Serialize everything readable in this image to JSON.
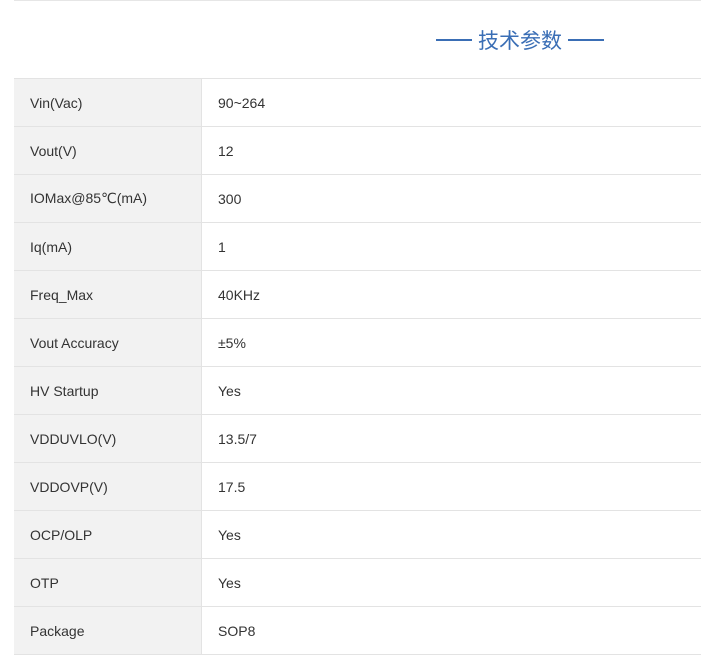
{
  "heading": {
    "title": "技术参数"
  },
  "specs": [
    {
      "param": "Vin(Vac)",
      "value": "90~264"
    },
    {
      "param": "Vout(V)",
      "value": "12"
    },
    {
      "param": "IOMax@85℃(mA)",
      "value": "300"
    },
    {
      "param": "Iq(mA)",
      "value": "1"
    },
    {
      "param": "Freq_Max",
      "value": "40KHz"
    },
    {
      "param": "Vout Accuracy",
      "value": "±5%"
    },
    {
      "param": "HV Startup",
      "value": "Yes"
    },
    {
      "param": "VDDUVLO(V)",
      "value": "13.5/7"
    },
    {
      "param": "VDDOVP(V)",
      "value": "17.5"
    },
    {
      "param": "OCP/OLP",
      "value": "Yes"
    },
    {
      "param": "OTP",
      "value": "Yes"
    },
    {
      "param": "Package",
      "value": "SOP8"
    }
  ],
  "colors": {
    "accent": "#3a6eb5",
    "label_cell_bg": "#f2f2f2",
    "border": "#e3e3e3"
  }
}
